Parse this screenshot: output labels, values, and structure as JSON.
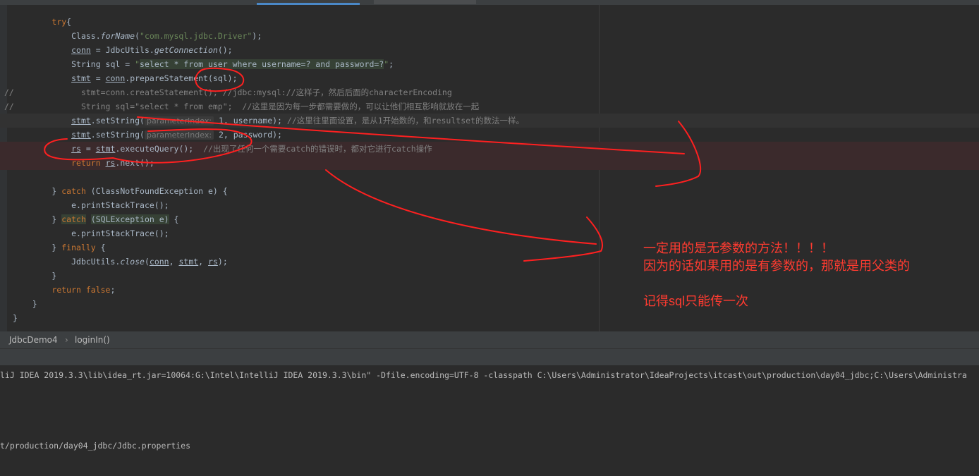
{
  "editor": {
    "lines": [
      {
        "indent": "        ",
        "parts": [
          [
            "kw",
            "try"
          ],
          [
            "",
            "{"
          ]
        ]
      },
      {
        "indent": "            ",
        "parts": [
          [
            "",
            "Class."
          ],
          [
            "it",
            "forName"
          ],
          [
            "",
            "("
          ],
          [
            "str",
            "\"com.mysql.jdbc.Driver\""
          ],
          [
            "",
            ");"
          ]
        ]
      },
      {
        "indent": "            ",
        "parts": [
          [
            "ul",
            "conn"
          ],
          [
            "",
            " = JdbcUtils."
          ],
          [
            "it",
            "getConnection"
          ],
          [
            "",
            "();"
          ]
        ]
      },
      {
        "indent": "            ",
        "parts": [
          [
            "",
            "String sql = "
          ],
          [
            "str",
            "\""
          ],
          [
            "sqlbg",
            "select * from user where username=? and password=?"
          ],
          [
            "str",
            "\""
          ],
          [
            "",
            ";"
          ]
        ]
      },
      {
        "indent": "            ",
        "parts": [
          [
            "ul",
            "stmt"
          ],
          [
            "",
            " = "
          ],
          [
            "ul",
            "conn"
          ],
          [
            "",
            ".prepareStatement(sql);"
          ]
        ]
      },
      {
        "indent": "              ",
        "mark": "//",
        "parts": [
          [
            "cm",
            "stmt=conn.createStatement(); //jdbc:mysql://这样子，然后后面的characterEncoding"
          ]
        ]
      },
      {
        "indent": "              ",
        "mark": "//",
        "parts": [
          [
            "cm",
            "String sql=\"select * from emp\";  //这里是因为每一步都需要做的，可以让他们相互影响就放在一起"
          ]
        ]
      },
      {
        "indent": "            ",
        "caret": true,
        "parts": [
          [
            "ul",
            "stmt"
          ],
          [
            "",
            ".setString("
          ],
          [
            "hint",
            "parameterIndex:"
          ],
          [
            "",
            " 1, username); "
          ],
          [
            "cm",
            "//这里往里面设置，是从1开始数的，和resultset的数法一样。"
          ]
        ]
      },
      {
        "indent": "            ",
        "parts": [
          [
            "ul",
            "stmt"
          ],
          [
            "",
            ".setString("
          ],
          [
            "hint",
            "parameterIndex:"
          ],
          [
            "",
            " 2, password);"
          ]
        ]
      },
      {
        "indent": "            ",
        "err": true,
        "parts": [
          [
            "ul",
            "rs"
          ],
          [
            "",
            " = "
          ],
          [
            "ul",
            "stmt"
          ],
          [
            "",
            ".executeQuery();  "
          ],
          [
            "cm",
            "//出现了任何一个需要catch的错误时，都对它进行catch操作"
          ]
        ]
      },
      {
        "indent": "            ",
        "err": true,
        "parts": [
          [
            "kw",
            "return "
          ],
          [
            "ul",
            "rs"
          ],
          [
            "",
            ".next();"
          ]
        ]
      },
      {
        "indent": "",
        "parts": []
      },
      {
        "indent": "        ",
        "parts": [
          [
            "",
            "} "
          ],
          [
            "kw",
            "catch"
          ],
          [
            "",
            " (ClassNotFoundException e) {"
          ]
        ]
      },
      {
        "indent": "            ",
        "parts": [
          [
            "",
            "e.printStackTrace();"
          ]
        ]
      },
      {
        "indent": "        ",
        "parts": [
          [
            "",
            "} "
          ],
          [
            "kw sqlbg",
            "catch"
          ],
          [
            "",
            " "
          ],
          [
            "sqlbg",
            "(SQLException e)"
          ],
          [
            "",
            " {"
          ]
        ]
      },
      {
        "indent": "            ",
        "parts": [
          [
            "",
            "e.printStackTrace();"
          ]
        ]
      },
      {
        "indent": "        ",
        "parts": [
          [
            "",
            "} "
          ],
          [
            "kw",
            "finally"
          ],
          [
            "",
            " {"
          ]
        ]
      },
      {
        "indent": "            ",
        "parts": [
          [
            "",
            "JdbcUtils."
          ],
          [
            "it",
            "close"
          ],
          [
            "",
            "("
          ],
          [
            "ul",
            "conn"
          ],
          [
            "",
            ", "
          ],
          [
            "ul",
            "stmt"
          ],
          [
            "",
            ", "
          ],
          [
            "ul",
            "rs"
          ],
          [
            "",
            ");"
          ]
        ]
      },
      {
        "indent": "        ",
        "parts": [
          [
            "",
            "}"
          ]
        ]
      },
      {
        "indent": "        ",
        "parts": [
          [
            "kw",
            "return false"
          ],
          [
            "",
            ";"
          ]
        ]
      },
      {
        "indent": "    ",
        "parts": [
          [
            "",
            "}"
          ]
        ]
      },
      {
        "indent": "",
        "parts": [
          [
            "",
            "}"
          ]
        ]
      }
    ]
  },
  "breadcrumb": {
    "class_name": "JdbcDemo4",
    "separator": "›",
    "method_name": "loginIn()"
  },
  "console": {
    "line1": "liJ IDEA 2019.3.3\\lib\\idea_rt.jar=10064:G:\\Intel\\IntelliJ IDEA 2019.3.3\\bin\" -Dfile.encoding=UTF-8 -classpath C:\\Users\\Administrator\\IdeaProjects\\itcast\\out\\production\\day04_jdbc;C:\\Users\\Administra",
    "line2": "t/production/day04_jdbc/Jdbc.properties"
  },
  "annotations": {
    "note1": "一定用的是无参数的方法！！！！",
    "note2": "因为的话如果用的是有参数的，那就是用父类的",
    "note3": "记得sql只能传一次",
    "ink_color": "#ff2020"
  }
}
